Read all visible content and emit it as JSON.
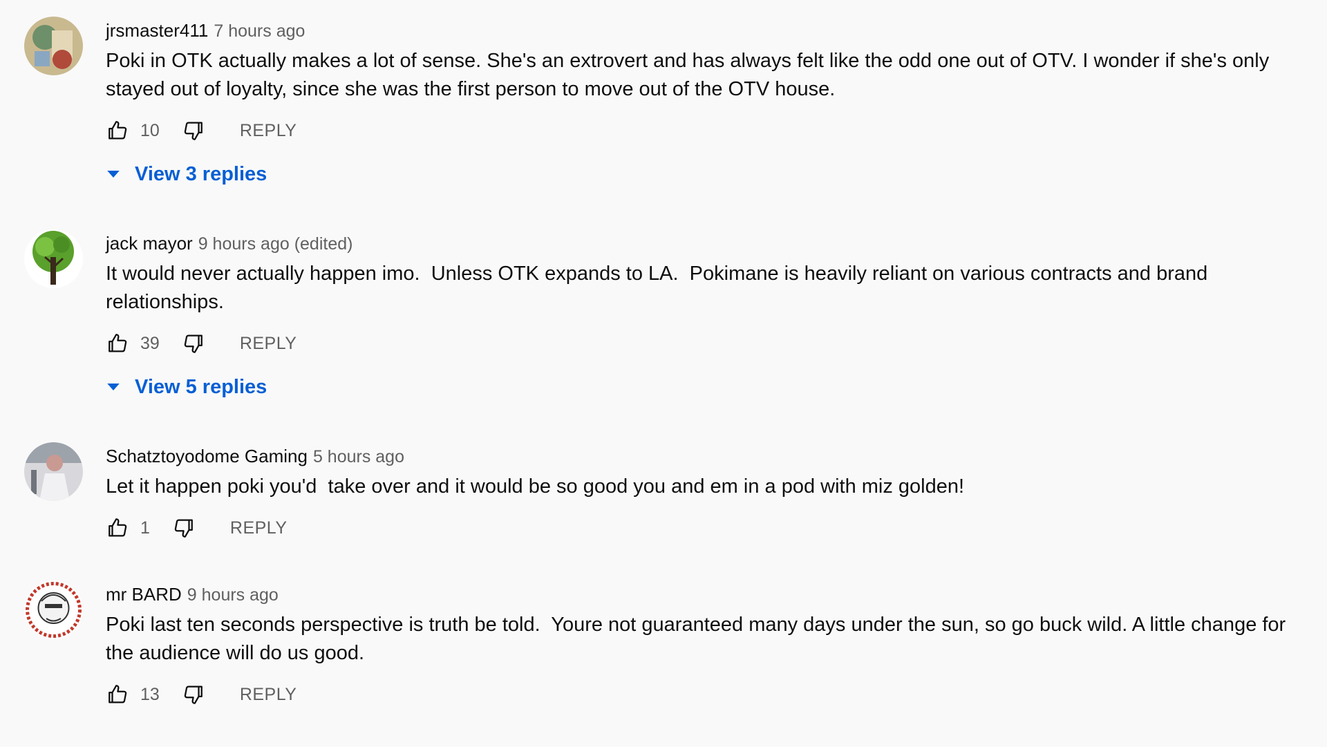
{
  "comments": [
    {
      "author": "jrsmaster411",
      "time": "7 hours ago",
      "text": "Poki in OTK actually makes a lot of sense. She's an extrovert and has always felt like the odd one out of OTV. I wonder if she's only stayed out of loyalty, since she was the first person to move out of the OTV house.",
      "likes": "10",
      "reply_label": "REPLY",
      "replies_label": "View 3 replies"
    },
    {
      "author": "jack mayor",
      "time": "9 hours ago (edited)",
      "text": "It would never actually happen imo.  Unless OTK expands to LA.  Pokimane is heavily reliant on various contracts and brand relationships.",
      "likes": "39",
      "reply_label": "REPLY",
      "replies_label": "View 5 replies"
    },
    {
      "author": "Schatztoyodome Gaming",
      "time": "5 hours ago",
      "text": "Let it happen poki you'd  take over and it would be so good you and em in a pod with miz golden!",
      "likes": "1",
      "reply_label": "REPLY"
    },
    {
      "author": "mr BARD",
      "time": "9 hours ago",
      "text": "Poki last ten seconds perspective is truth be told.  Youre not guaranteed many days under the sun, so go buck wild. A little change for the audience will do us good.",
      "likes": "13",
      "reply_label": "REPLY"
    }
  ],
  "icons": {
    "like": "thumbs-up-icon",
    "dislike": "thumbs-down-icon",
    "expand": "caret-down-icon"
  },
  "colors": {
    "background": "#f9f9f9",
    "link_blue": "#065fd4",
    "secondary_text": "#606060"
  }
}
